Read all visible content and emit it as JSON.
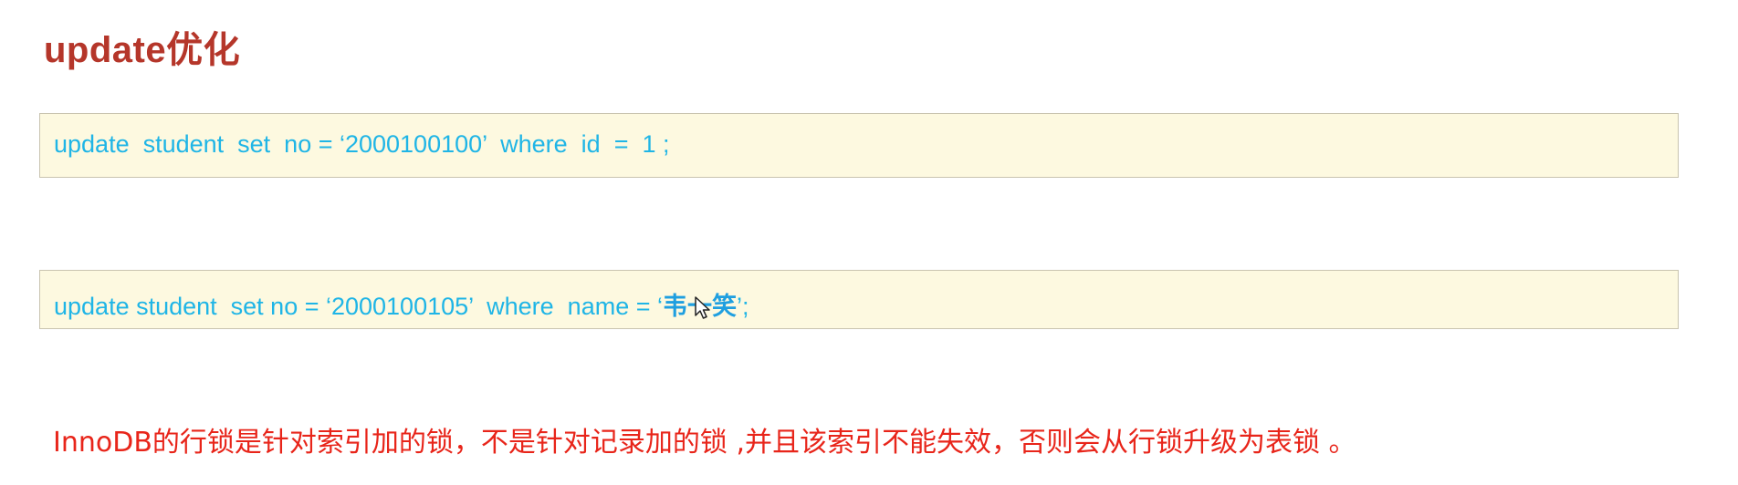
{
  "slide": {
    "title": "update优化"
  },
  "code_examples": [
    {
      "sql": "update  student  set  no = ‘2000100100’  where  id  =  1 ;"
    },
    {
      "sql_prefix": "update student  set no = ‘2000100105’  where  name = ‘",
      "sql_value": "韦一笑",
      "sql_suffix": "’;"
    }
  ],
  "note": {
    "text": "InnoDB的行锁是针对索引加的锁，不是针对记录加的锁 ,并且该索引不能失效，否则会从行锁升级为表锁 。"
  },
  "colors": {
    "title": "#b5362a",
    "code": "#1fb5e6",
    "code_box_bg": "#fdf9e0",
    "note": "#e8251a"
  },
  "icons": {
    "cursor": "mouse-pointer-icon"
  }
}
